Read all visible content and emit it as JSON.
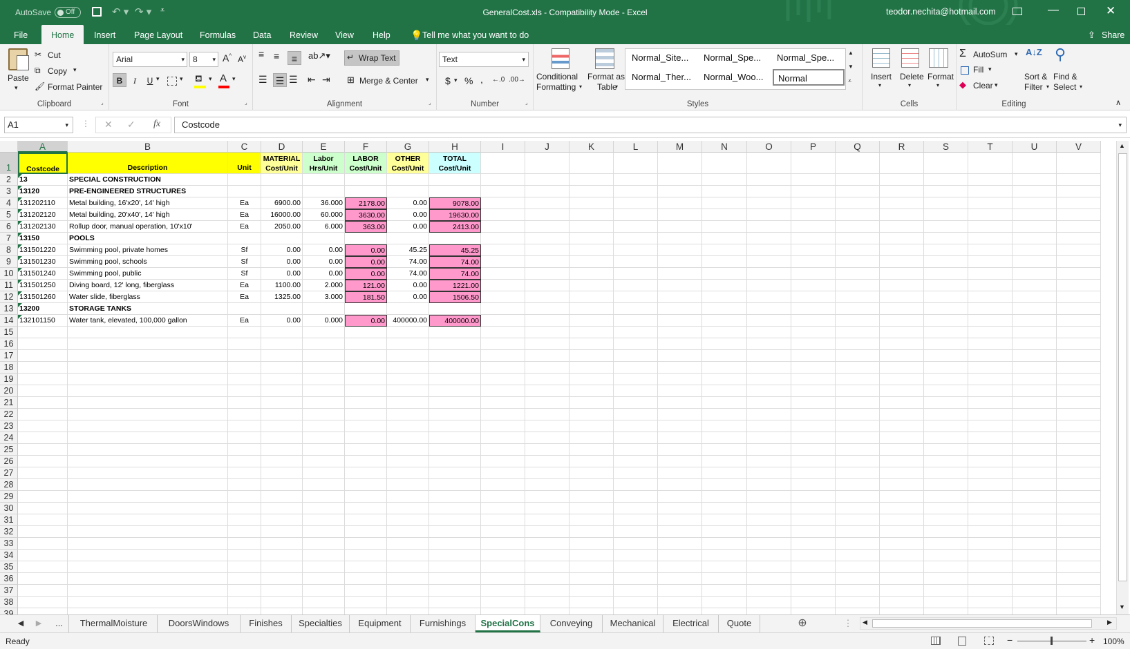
{
  "titlebar": {
    "autosave_label": "AutoSave",
    "autosave_state": "Off",
    "title": "GeneralCost.xls  -  Compatibility Mode  -  Excel",
    "user": "teodor.nechita@hotmail.com"
  },
  "menu": {
    "tabs": [
      "File",
      "Home",
      "Insert",
      "Page Layout",
      "Formulas",
      "Data",
      "Review",
      "View",
      "Help"
    ],
    "active": "Home",
    "tell_me": "Tell me what you want to do",
    "share": "Share"
  },
  "ribbon": {
    "clipboard": {
      "label": "Clipboard",
      "paste": "Paste",
      "cut": "Cut",
      "copy": "Copy",
      "format_painter": "Format Painter"
    },
    "font": {
      "label": "Font",
      "name": "Arial",
      "size": "8",
      "bold": "B",
      "italic": "I",
      "underline": "U"
    },
    "alignment": {
      "label": "Alignment",
      "wrap_text": "Wrap Text",
      "merge_center": "Merge & Center"
    },
    "number": {
      "label": "Number",
      "format": "Text",
      "currency": "$",
      "percent": "%",
      "comma": ","
    },
    "styles": {
      "label": "Styles",
      "conditional": "Conditional",
      "conditional2": "Formatting",
      "format_as": "Format as",
      "format_as2": "Table",
      "cells": [
        "Normal_Site...",
        "Normal_Spe...",
        "Normal_Spe...",
        "Normal_Ther...",
        "Normal_Woo...",
        "Normal"
      ]
    },
    "cells": {
      "label": "Cells",
      "insert": "Insert",
      "delete": "Delete",
      "format": "Format"
    },
    "editing": {
      "label": "Editing",
      "autosum": "AutoSum",
      "fill": "Fill",
      "clear": "Clear",
      "sort": "Sort &",
      "sort2": "Filter",
      "find": "Find &",
      "find2": "Select"
    }
  },
  "formula_bar": {
    "name_box": "A1",
    "fx": "fx",
    "value": "Costcode"
  },
  "columns": [
    "A",
    "B",
    "C",
    "D",
    "E",
    "F",
    "G",
    "H",
    "I",
    "J",
    "K",
    "L",
    "M",
    "N",
    "O",
    "P",
    "Q",
    "R",
    "S",
    "T",
    "U",
    "V"
  ],
  "header_row": [
    "Costcode",
    "Description",
    "Unit",
    "MATERIAL Cost/Unit",
    "Labor Hrs/Unit",
    "LABOR Cost/Unit",
    "OTHER Cost/Unit",
    "TOTAL Cost/Unit"
  ],
  "rows": [
    {
      "n": "2",
      "a": "13",
      "b": "SPECIAL CONSTRUCTION",
      "c": "",
      "d": "",
      "e": "",
      "f": "",
      "g": "",
      "h": "",
      "bold": true
    },
    {
      "n": "3",
      "a": "13120",
      "b": "PRE-ENGINEERED STRUCTURES",
      "c": "",
      "d": "",
      "e": "",
      "f": "",
      "g": "",
      "h": "",
      "bold": true
    },
    {
      "n": "4",
      "a": "131202110",
      "b": "Metal building, 16'x20', 14' high",
      "c": "Ea",
      "d": "6900.00",
      "e": "36.000",
      "f": "2178.00",
      "g": "0.00",
      "h": "9078.00"
    },
    {
      "n": "5",
      "a": "131202120",
      "b": "Metal building, 20'x40', 14' high",
      "c": "Ea",
      "d": "16000.00",
      "e": "60.000",
      "f": "3630.00",
      "g": "0.00",
      "h": "19630.00"
    },
    {
      "n": "6",
      "a": "131202130",
      "b": "Rollup door, manual operation, 10'x10'",
      "c": "Ea",
      "d": "2050.00",
      "e": "6.000",
      "f": "363.00",
      "g": "0.00",
      "h": "2413.00"
    },
    {
      "n": "7",
      "a": "13150",
      "b": "POOLS",
      "c": "",
      "d": "",
      "e": "",
      "f": "",
      "g": "",
      "h": "",
      "bold": true
    },
    {
      "n": "8",
      "a": "131501220",
      "b": "Swimming pool, private homes",
      "c": "Sf",
      "d": "0.00",
      "e": "0.00",
      "f": "0.00",
      "g": "45.25",
      "h": "45.25"
    },
    {
      "n": "9",
      "a": "131501230",
      "b": "Swimming pool, schools",
      "c": "Sf",
      "d": "0.00",
      "e": "0.00",
      "f": "0.00",
      "g": "74.00",
      "h": "74.00"
    },
    {
      "n": "10",
      "a": "131501240",
      "b": "Swimming pool, public",
      "c": "Sf",
      "d": "0.00",
      "e": "0.00",
      "f": "0.00",
      "g": "74.00",
      "h": "74.00"
    },
    {
      "n": "11",
      "a": "131501250",
      "b": "Diving board, 12' long, fiberglass",
      "c": "Ea",
      "d": "1100.00",
      "e": "2.000",
      "f": "121.00",
      "g": "0.00",
      "h": "1221.00"
    },
    {
      "n": "12",
      "a": "131501260",
      "b": "Water slide, fiberglass",
      "c": "Ea",
      "d": "1325.00",
      "e": "3.000",
      "f": "181.50",
      "g": "0.00",
      "h": "1506.50"
    },
    {
      "n": "13",
      "a": "13200",
      "b": "STORAGE TANKS",
      "c": "",
      "d": "",
      "e": "",
      "f": "",
      "g": "",
      "h": "",
      "bold": true
    },
    {
      "n": "14",
      "a": "132101150",
      "b": "Water tank, elevated, 100,000 gallon",
      "c": "Ea",
      "d": "0.00",
      "e": "0.000",
      "f": "0.00",
      "g": "400000.00",
      "h": "400000.00"
    }
  ],
  "empty_rows": [
    "15",
    "16",
    "17",
    "18",
    "19",
    "20",
    "21",
    "22",
    "23",
    "24",
    "25",
    "26",
    "27",
    "28",
    "29",
    "30",
    "31",
    "32",
    "33",
    "34",
    "35",
    "36",
    "37",
    "38",
    "39"
  ],
  "sheet_tabs": {
    "tabs": [
      "ThermalMoisture",
      "DoorsWindows",
      "Finishes",
      "Specialties",
      "Equipment",
      "Furnishings",
      "SpecialCons",
      "Conveying",
      "Mechanical",
      "Electrical",
      "Quote"
    ],
    "active": "SpecialCons",
    "ellipsis": "..."
  },
  "status": {
    "ready": "Ready",
    "zoom": "100%"
  },
  "colors": {
    "excel_green": "#217346",
    "header_yellow": "#ffff00",
    "header_green": "#ccffcc",
    "header_orange": "#ffff99",
    "header_cyan": "#ccffff",
    "pink": "#ff99cc"
  }
}
